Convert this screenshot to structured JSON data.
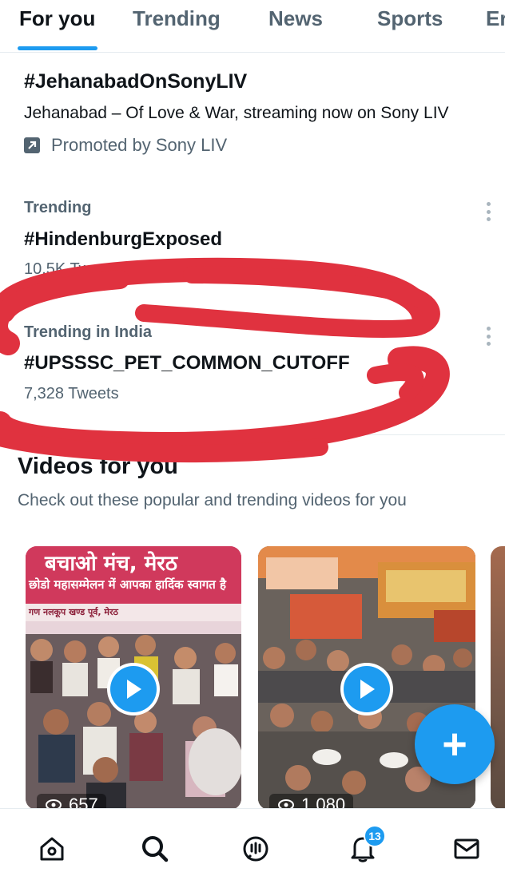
{
  "tabs": [
    {
      "label": "For you",
      "active": true
    },
    {
      "label": "Trending",
      "active": false
    },
    {
      "label": "News",
      "active": false
    },
    {
      "label": "Sports",
      "active": false
    },
    {
      "label": "Er",
      "active": false
    }
  ],
  "promoted": {
    "hashtag": "#JehanabadOnSonyLIV",
    "description": "Jehanabad – Of Love & War, streaming now on Sony LIV",
    "promoted_by": "Promoted by Sony LIV",
    "icon": "promoted-arrow-icon"
  },
  "trends": [
    {
      "context": "Trending",
      "name": "#HindenburgExposed",
      "count": "10.5K Tweets"
    },
    {
      "context": "Trending in India",
      "name": "#UPSSSC_PET_COMMON_CUTOFF",
      "count": "7,328 Tweets"
    }
  ],
  "videos": {
    "title": "Videos for you",
    "subtitle": "Check out these popular and trending videos for you",
    "items": [
      {
        "views": "657",
        "banner_line1": "बचाओ मंच, मेरठ",
        "banner_line2": "छोडो महासम्मेलन में आपका हार्दिक स्वागत है",
        "banner_line3": "गण नलकूप खण्ड पूर्व, मेरठ"
      },
      {
        "views": "1,080"
      },
      {
        "views": ""
      }
    ]
  },
  "fab": {
    "icon": "plus-icon",
    "label": "+"
  },
  "bottom_nav": {
    "items": [
      "home-icon",
      "search-icon",
      "spaces-icon",
      "notifications-icon",
      "messages-icon"
    ],
    "notification_count": "13"
  },
  "colors": {
    "accent": "#1d9bf0",
    "text_primary": "#0f1419",
    "text_secondary": "#536471",
    "annotation": "#e0323f"
  }
}
